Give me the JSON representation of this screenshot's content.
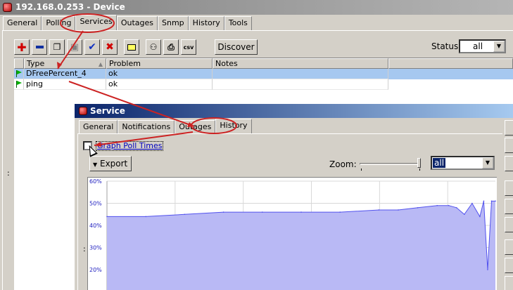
{
  "window": {
    "title": "192.168.0.253 - Device"
  },
  "device_tabs": [
    "General",
    "Polling",
    "Services",
    "Outages",
    "Snmp",
    "History",
    "Tools"
  ],
  "device_active_tab": 2,
  "toolbar": {
    "add_icon": "plus-icon",
    "remove_icon": "minus-icon",
    "copy_icon": "copy-icon",
    "paste_icon": "paste-icon",
    "apply_icon": "check-icon",
    "cancel_icon": "x-icon",
    "note_icon": "note-icon",
    "find_icon": "binoculars-icon",
    "print_icon": "printer-icon",
    "csv_label": "csv",
    "discover_label": "Discover",
    "status_label": "Status:",
    "status_value": "all"
  },
  "table": {
    "columns": [
      "Type",
      "Problem",
      "Notes"
    ],
    "rows": [
      {
        "type": "DFreePercent_4",
        "problem": "ok",
        "notes": "",
        "selected": true
      },
      {
        "type": "ping",
        "problem": "ok",
        "notes": "",
        "selected": false
      }
    ]
  },
  "service": {
    "title": "Service",
    "tabs": [
      "General",
      "Notifications",
      "Outages",
      "History"
    ],
    "active_tab": 3,
    "graph_poll_times_label": "Graph Poll Times",
    "export_label": "Export",
    "zoom_label": "Zoom:",
    "zoom_value": "all",
    "zoom_level": 1.0
  },
  "colors": {
    "series_fill": "#b9b9f5",
    "series_line": "#5252ee",
    "highlight": "#cc2222"
  },
  "chart_data": {
    "type": "area",
    "ylim": [
      0,
      60
    ],
    "yticks": [
      "60%",
      "50%",
      "40%",
      "30%",
      "20%"
    ],
    "y_unit": "%",
    "x_gridlines": 6,
    "series": [
      {
        "x": [
          0,
          10,
          20,
          30,
          40,
          50,
          60,
          70,
          75,
          80,
          85,
          88,
          90,
          92,
          94,
          96,
          97,
          98,
          99,
          100
        ],
        "values": [
          44,
          44,
          45,
          46,
          46,
          46,
          46,
          47,
          47,
          48,
          49,
          49,
          48,
          45,
          50,
          44,
          51,
          20,
          51,
          51
        ]
      }
    ]
  }
}
